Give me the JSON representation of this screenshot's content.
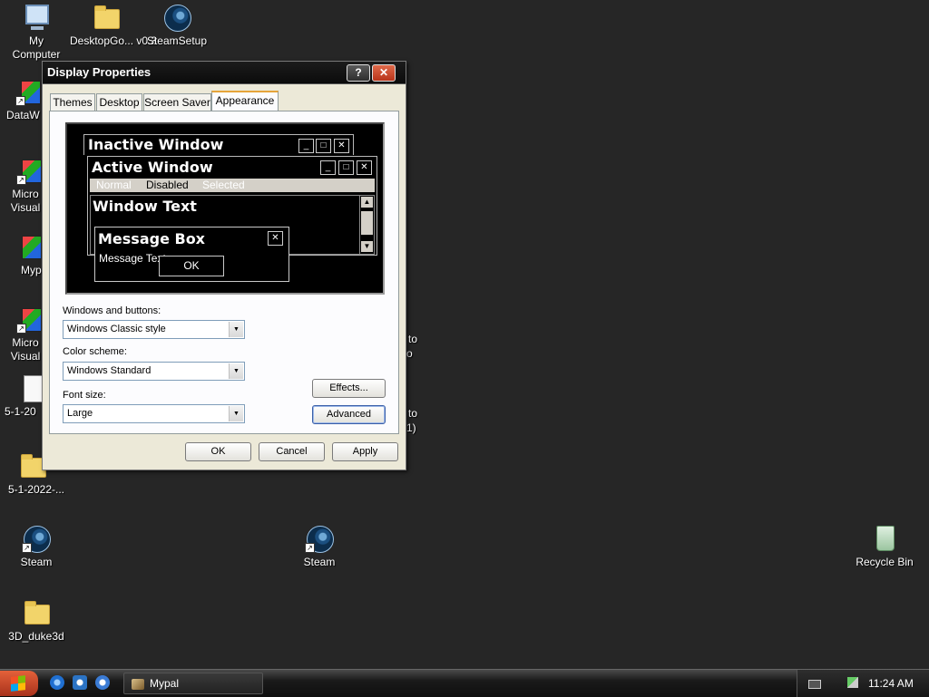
{
  "desktop": {
    "icons": [
      {
        "label": "My Computer",
        "icon": "my-computer-icon"
      },
      {
        "label": "DesktopGo... v0.3",
        "icon": "folder-icon"
      },
      {
        "label": "SteamSetup",
        "icon": "steam-icon"
      },
      {
        "label": "DataW",
        "icon": "application-icon"
      },
      {
        "label": "Micro Visual",
        "icon": "application-icon"
      },
      {
        "label": "Myp",
        "icon": "application-icon"
      },
      {
        "label": "Micro Visual",
        "icon": "application-icon"
      },
      {
        "label": "5-1-20",
        "icon": "document-icon"
      },
      {
        "label": "5-1-2022-...",
        "icon": "folder-icon"
      },
      {
        "label": "Steam",
        "icon": "steam-icon"
      },
      {
        "label": "Steam",
        "icon": "steam-icon"
      },
      {
        "label": "Recycle Bin",
        "icon": "recycle-bin-icon"
      },
      {
        "label": "3D_duke3d",
        "icon": "folder-icon"
      }
    ],
    "bleed_text": [
      "to",
      "o",
      "to",
      "1)"
    ]
  },
  "dialog": {
    "title": "Display Properties",
    "help_label": "?",
    "close_label": "✕",
    "tabs": [
      "Themes",
      "Desktop",
      "Screen Saver",
      "Appearance"
    ],
    "active_tab": "Appearance",
    "preview": {
      "inactive_title": "Inactive Window",
      "active_title": "Active Window",
      "menu_normal": "Normal",
      "menu_disabled": "Disabled",
      "menu_selected": "Selected",
      "window_text": "Window Text",
      "message_box_title": "Message Box",
      "message_text": "Message Text",
      "ok_label": "OK"
    },
    "fields": {
      "windows_buttons_label": "Windows and buttons:",
      "windows_buttons_value": "Windows Classic style",
      "color_scheme_label": "Color scheme:",
      "color_scheme_value": "Windows Standard",
      "font_size_label": "Font size:",
      "font_size_value": "Large"
    },
    "buttons": {
      "effects": "Effects...",
      "advanced": "Advanced",
      "ok": "OK",
      "cancel": "Cancel",
      "apply": "Apply"
    }
  },
  "taskbar": {
    "task_label": "Mypal",
    "clock": "11:24 AM"
  }
}
